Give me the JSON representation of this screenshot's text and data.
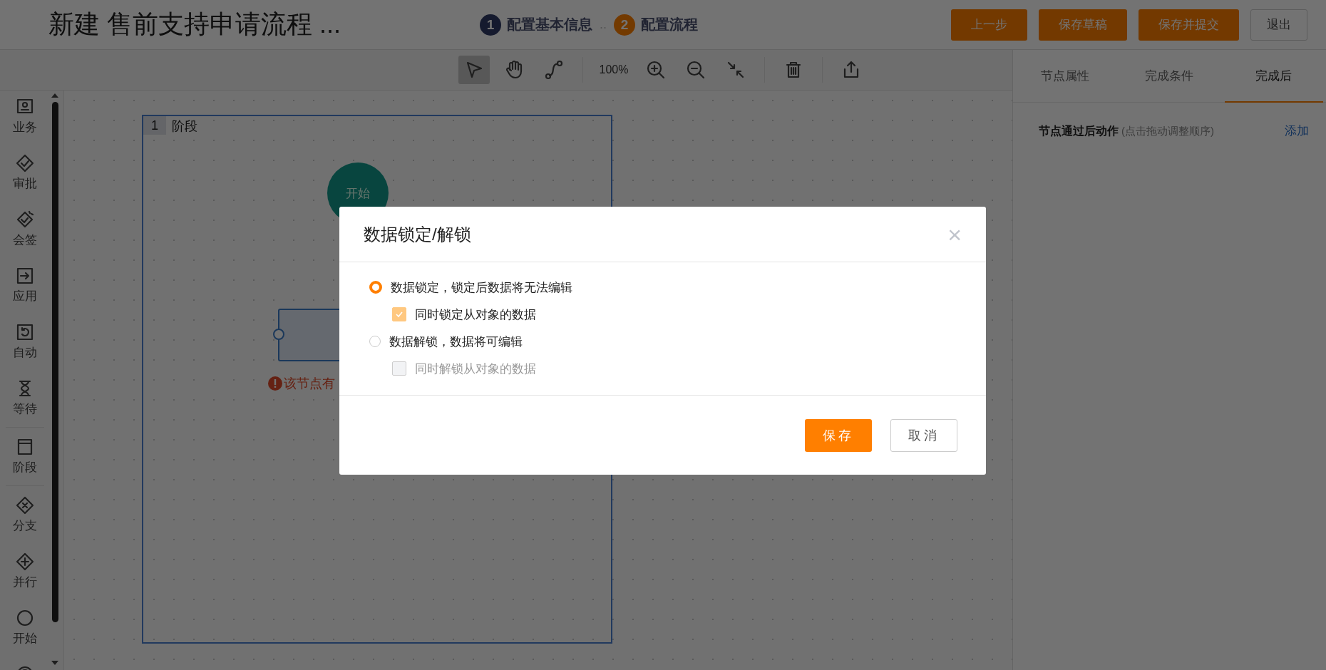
{
  "window": {
    "title": "新建 售前支持申请流程 ..."
  },
  "steps": [
    {
      "number": "1",
      "label": "配置基本信息",
      "selected": false
    },
    {
      "number": "2",
      "label": "配置流程",
      "selected": true
    }
  ],
  "step_separator": "..",
  "header_buttons": [
    {
      "label": "上一步",
      "kind": "primary"
    },
    {
      "label": "保存草稿",
      "kind": "primary"
    },
    {
      "label": "保存并提交",
      "kind": "primary"
    },
    {
      "label": "退出",
      "kind": "default"
    }
  ],
  "toolbar": {
    "tools": [
      {
        "kind": "pointer",
        "selected": true
      },
      {
        "kind": "hand",
        "selected": false
      },
      {
        "kind": "connector",
        "selected": false
      }
    ],
    "zoom_level": "100%"
  },
  "palette_groups": [
    {
      "items": [
        {
          "kind": "task",
          "label": "业务"
        },
        {
          "kind": "approve",
          "label": "审批"
        },
        {
          "kind": "countersign",
          "label": "会签"
        },
        {
          "kind": "app",
          "label": "应用"
        },
        {
          "kind": "auto",
          "label": "自动"
        },
        {
          "kind": "wait",
          "label": "等待"
        }
      ]
    },
    {
      "items": [
        {
          "kind": "stage",
          "label": "阶段"
        }
      ]
    },
    {
      "items": [
        {
          "kind": "branch",
          "label": "分支"
        },
        {
          "kind": "parallel",
          "label": "并行"
        },
        {
          "kind": "start",
          "label": "开始"
        },
        {
          "kind": "end"
        }
      ]
    }
  ],
  "canvas": {
    "stage": {
      "number": "1",
      "label": "阶段"
    },
    "start_node": {
      "label": "开始"
    },
    "warning": "该节点有"
  },
  "right_panel": {
    "tabs": [
      {
        "label": "节点属性",
        "selected": false
      },
      {
        "label": "完成条件",
        "selected": false
      },
      {
        "label": "完成后",
        "selected": true
      }
    ],
    "section": {
      "title": "节点通过后动作",
      "hint": "(点击拖动调整顺序)",
      "action": "添加"
    }
  },
  "dialog": {
    "title": "数据锁定/解锁",
    "close": "×",
    "options": [
      {
        "label": "数据锁定，锁定后数据将无法编辑",
        "selected": true,
        "sub": {
          "label": "同时锁定从对象的数据",
          "checked": true,
          "disabled": false
        }
      },
      {
        "label": "数据解锁，数据将可编辑",
        "selected": false,
        "sub": {
          "label": "同时解锁从对象的数据",
          "checked": false,
          "disabled": true
        }
      }
    ],
    "buttons": [
      {
        "label": "保存",
        "kind": "primary"
      },
      {
        "label": "取消",
        "kind": "default"
      }
    ]
  }
}
